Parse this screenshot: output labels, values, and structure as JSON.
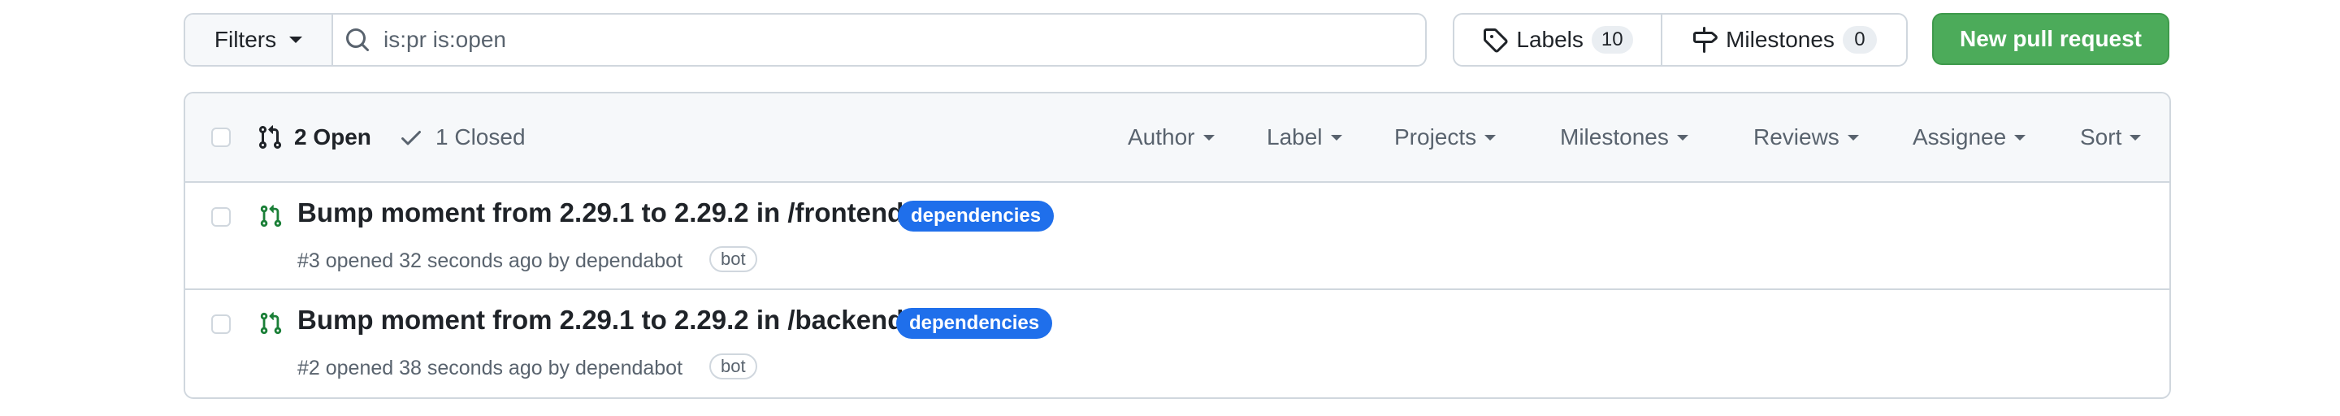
{
  "toolbar": {
    "filters_label": "Filters",
    "search_value": "is:pr is:open",
    "labels_label": "Labels",
    "labels_count": "10",
    "milestones_label": "Milestones",
    "milestones_count": "0",
    "new_pr_label": "New pull request"
  },
  "list_header": {
    "open_label": "2 Open",
    "closed_label": "1 Closed",
    "filters": [
      "Author",
      "Label",
      "Projects",
      "Milestones",
      "Reviews",
      "Assignee",
      "Sort"
    ]
  },
  "pull_requests": [
    {
      "title": "Bump moment from 2.29.1 to 2.29.2 in /frontend",
      "label": "dependencies",
      "meta_prefix": "#3 opened 32 seconds ago by",
      "author": "dependabot",
      "badge": "bot"
    },
    {
      "title": "Bump moment from 2.29.1 to 2.29.2 in /backend",
      "label": "dependencies",
      "meta_prefix": "#2 opened 38 seconds ago by",
      "author": "dependabot",
      "badge": "bot"
    }
  ],
  "colors": {
    "primary_button": "#4cab5a",
    "label_blue": "#1f6feb",
    "open_pr_icon": "#1a7f37",
    "border": "#d0d7de"
  },
  "icons": {
    "search": "search-icon",
    "tag": "tag-icon",
    "milestone": "milestone-icon",
    "pull_request": "git-pull-request-icon",
    "check": "check-icon",
    "caret": "triangle-down-icon"
  }
}
